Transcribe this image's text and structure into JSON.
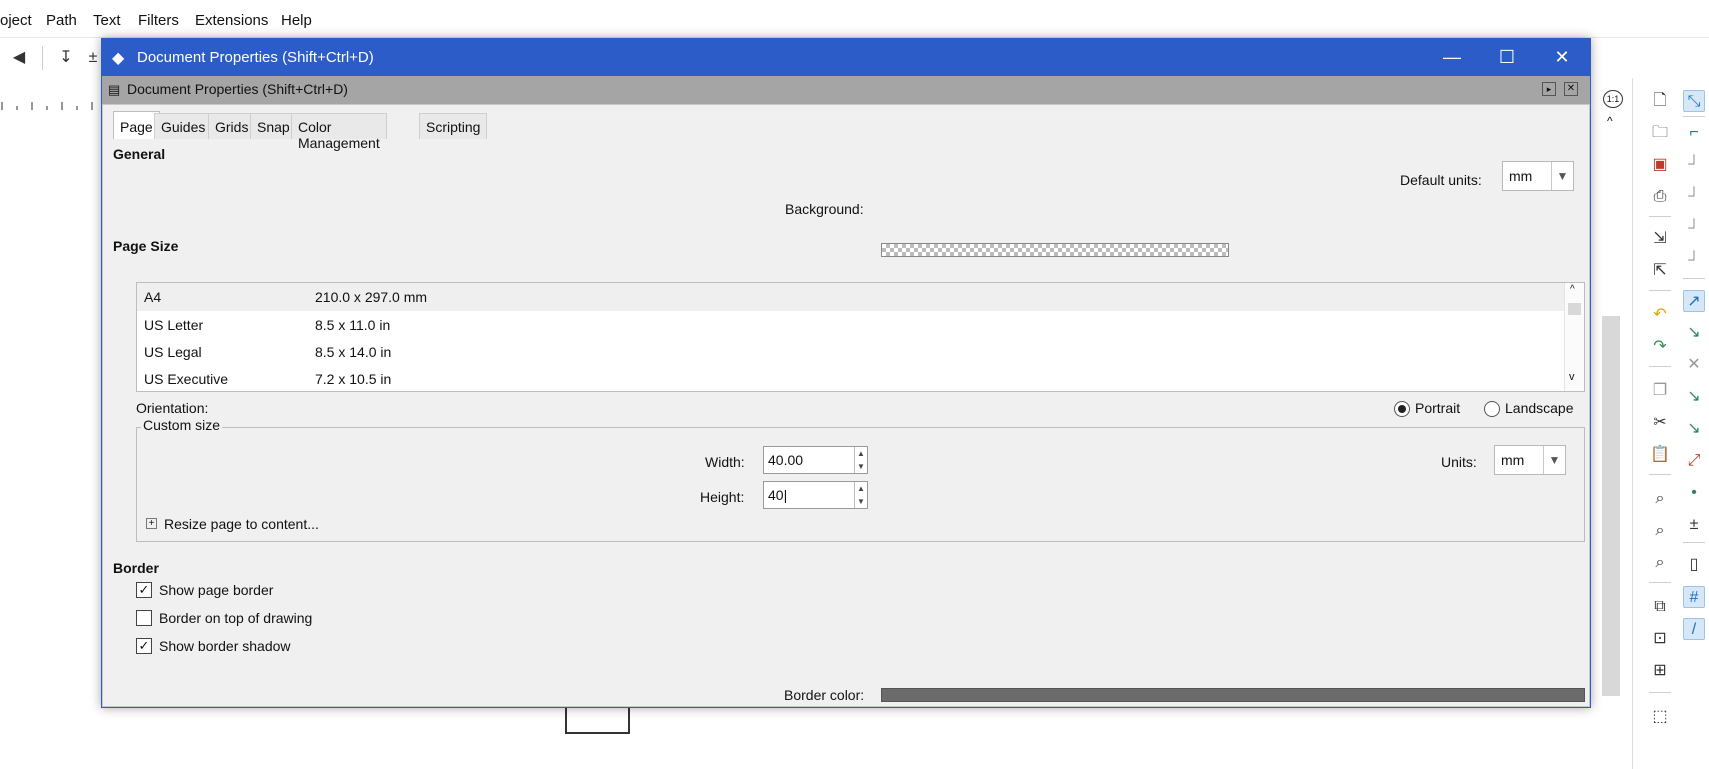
{
  "menubar": {
    "items": [
      "oject",
      "Path",
      "Text",
      "Filters",
      "Extensions",
      "Help"
    ]
  },
  "right_toolbar": {
    "zoom_label": "1:1"
  },
  "window": {
    "title": "Document Properties (Shift+Ctrl+D)",
    "minimize": "—",
    "maximize": "☐",
    "close": "✕"
  },
  "panel": {
    "title": "Document Properties (Shift+Ctrl+D)"
  },
  "tabs": [
    "Page",
    "Guides",
    "Grids",
    "Snap",
    "Color Management",
    "Scripting"
  ],
  "general": {
    "header": "General",
    "default_units_label": "Default units:",
    "default_units_value": "mm",
    "background_label": "Background:"
  },
  "page_size": {
    "header": "Page Size",
    "rows": [
      {
        "name": "A4",
        "size": "210.0 x 297.0 mm"
      },
      {
        "name": "US Letter",
        "size": "8.5 x 11.0 in"
      },
      {
        "name": "US Legal",
        "size": "8.5 x 14.0 in"
      },
      {
        "name": "US Executive",
        "size": "7.2 x 10.5 in"
      }
    ]
  },
  "orientation": {
    "label": "Orientation:",
    "portrait": "Portrait",
    "landscape": "Landscape",
    "selected": "Portrait"
  },
  "custom_size": {
    "label": "Custom size",
    "width_label": "Width:",
    "width_value": "40.00",
    "height_label": "Height:",
    "height_value": "40",
    "units_label": "Units:",
    "units_value": "mm",
    "resize_label": "Resize page to content..."
  },
  "border": {
    "header": "Border",
    "show_page_border": "Show page border",
    "show_page_border_checked": true,
    "border_on_top": "Border on top of drawing",
    "border_on_top_checked": false,
    "show_border_shadow": "Show border shadow",
    "show_border_shadow_checked": true,
    "border_color_label": "Border color:",
    "border_color": "#6b6b6b"
  },
  "colors": {
    "titlebar": "#2b5cc7",
    "dialog_bg": "#f0f0f0"
  }
}
